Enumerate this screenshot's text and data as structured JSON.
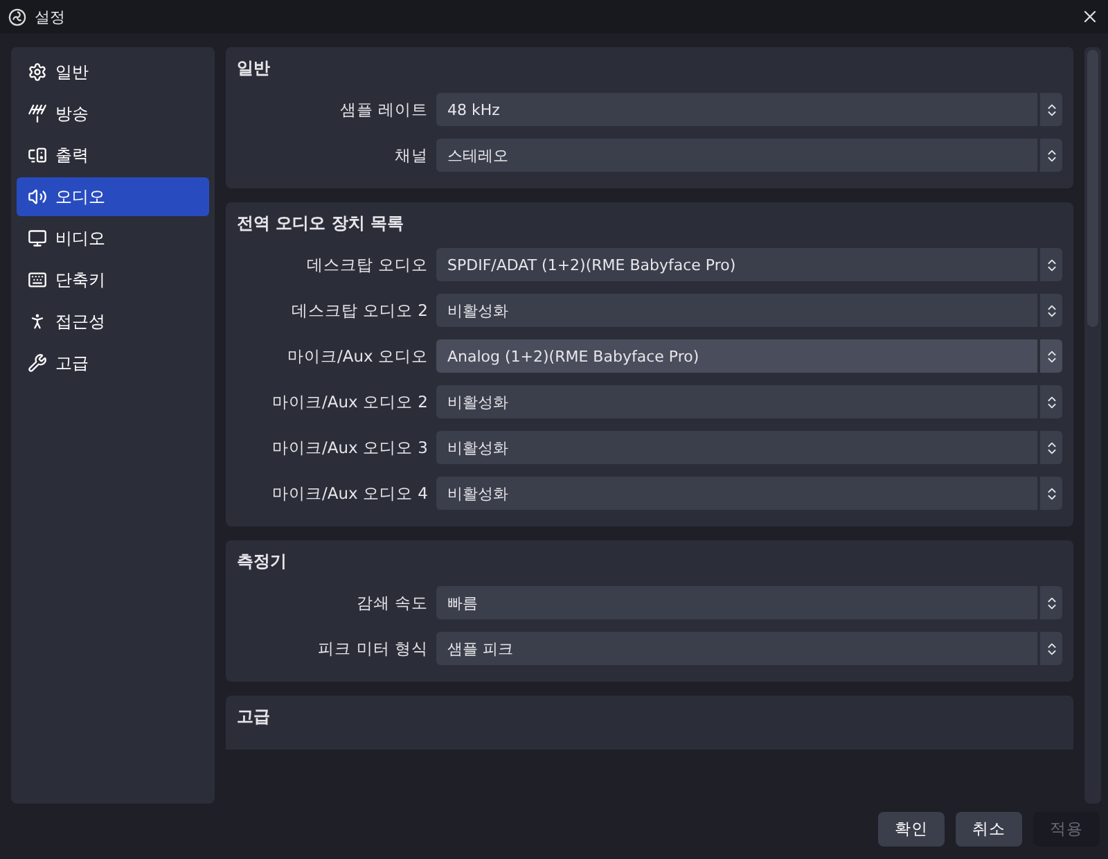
{
  "window": {
    "title": "설정"
  },
  "sidebar": {
    "items": [
      {
        "label": "일반",
        "selected": false
      },
      {
        "label": "방송",
        "selected": false
      },
      {
        "label": "출력",
        "selected": false
      },
      {
        "label": "오디오",
        "selected": true
      },
      {
        "label": "비디오",
        "selected": false
      },
      {
        "label": "단축키",
        "selected": false
      },
      {
        "label": "접근성",
        "selected": false
      },
      {
        "label": "고급",
        "selected": false
      }
    ]
  },
  "sections": [
    {
      "title": "일반",
      "rows": [
        {
          "label": "샘플 레이트",
          "value": "48 kHz",
          "hovered": false
        },
        {
          "label": "채널",
          "value": "스테레오",
          "hovered": false
        }
      ]
    },
    {
      "title": "전역 오디오 장치 목록",
      "rows": [
        {
          "label": "데스크탑 오디오",
          "value": "SPDIF/ADAT (1+2)(RME Babyface Pro)",
          "hovered": false
        },
        {
          "label": "데스크탑 오디오 2",
          "value": "비활성화",
          "hovered": false
        },
        {
          "label": "마이크/Aux 오디오",
          "value": "Analog (1+2)(RME Babyface Pro)",
          "hovered": true
        },
        {
          "label": "마이크/Aux 오디오 2",
          "value": "비활성화",
          "hovered": false
        },
        {
          "label": "마이크/Aux 오디오 3",
          "value": "비활성화",
          "hovered": false
        },
        {
          "label": "마이크/Aux 오디오 4",
          "value": "비활성화",
          "hovered": false
        }
      ]
    },
    {
      "title": "측정기",
      "rows": [
        {
          "label": "감쇄 속도",
          "value": "빠름",
          "hovered": false
        },
        {
          "label": "피크 미터 형식",
          "value": "샘플 피크",
          "hovered": false
        }
      ]
    },
    {
      "title": "고급"
    }
  ],
  "buttons": [
    {
      "label": "확인",
      "disabled": false
    },
    {
      "label": "취소",
      "disabled": false
    },
    {
      "label": "적용",
      "disabled": true
    }
  ]
}
